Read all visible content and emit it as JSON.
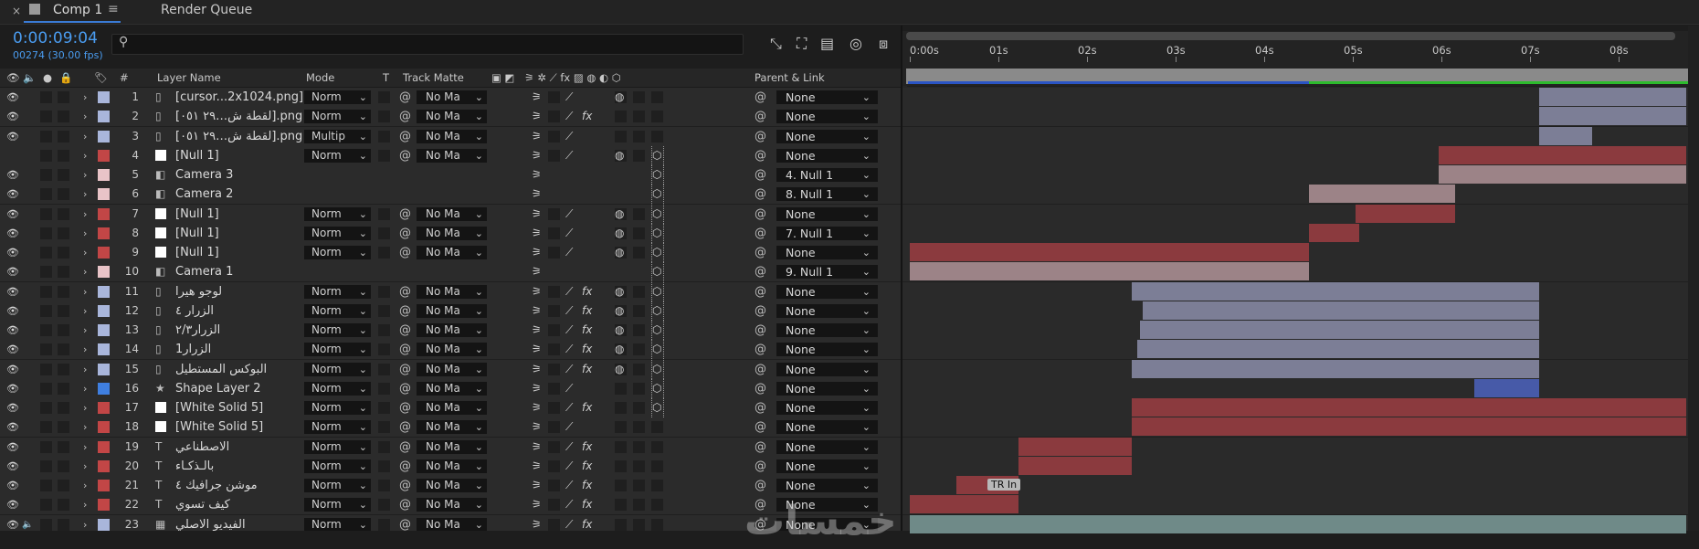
{
  "tabs": [
    {
      "label": "Comp 1",
      "active": true
    },
    {
      "label": "Render Queue",
      "active": false
    }
  ],
  "tab_close_glyph": "×",
  "tab_menu_glyph": "≡",
  "timecode": "0:00:09:04",
  "frame_info": "00274 (30.00 fps)",
  "search_icon_glyph": "⚲",
  "toolbar_icons": [
    {
      "name": "comp-flowchart-icon",
      "glyph": "⤡"
    },
    {
      "name": "draft-3d-icon",
      "glyph": "⛶"
    },
    {
      "name": "frame-blending-icon",
      "glyph": "▤"
    },
    {
      "name": "motion-blur-icon",
      "glyph": "◎"
    },
    {
      "name": "graph-editor-icon",
      "glyph": "⧈"
    }
  ],
  "columns": {
    "layer_name": "Layer Name",
    "mode": "Mode",
    "t": "T",
    "track_matte": "Track Matte",
    "parent": "Parent & Link",
    "num": "#"
  },
  "dropdown_glyph": "⌄",
  "rows": [
    {
      "num": "1",
      "name": "[cursor...2x1024.png]",
      "type": "footage",
      "color": "#a9b6db",
      "mode": "Norm",
      "matte": "No Ma",
      "parent": "None",
      "eye": true,
      "audio": false,
      "fx": false,
      "motionblur": true,
      "three_d": false,
      "solid_icon": false
    },
    {
      "num": "2",
      "name": "[لقطة ش…٢٩ ٠٥١].png",
      "type": "footage",
      "color": "#a9b6db",
      "mode": "Norm",
      "matte": "No Ma",
      "parent": "None",
      "eye": true,
      "audio": false,
      "fx": true,
      "motionblur": false,
      "three_d": false
    },
    {
      "num": "3",
      "name": "[لقطة ش…٢٩ ٠٥١].png",
      "type": "footage",
      "color": "#a9b6db",
      "mode": "Multip",
      "matte": "No Ma",
      "parent": "None",
      "eye": true,
      "audio": false,
      "fx": false,
      "motionblur": false,
      "three_d": false
    },
    {
      "num": "4",
      "name": "[Null 1]",
      "type": "null",
      "color": "#c24646",
      "mode": "Norm",
      "matte": "No Ma",
      "parent": "None",
      "eye": false,
      "audio": false,
      "fx": false,
      "motionblur": true,
      "three_d": true
    },
    {
      "num": "5",
      "name": "Camera 3",
      "type": "camera",
      "color": "#e9c4c8",
      "mode": "",
      "matte": "",
      "parent": "4. Null 1",
      "eye": true,
      "audio": false,
      "fx": false,
      "motionblur": false,
      "three_d": true
    },
    {
      "num": "6",
      "name": "Camera 2",
      "type": "camera",
      "color": "#e9c4c8",
      "mode": "",
      "matte": "",
      "parent": "8. Null 1",
      "eye": true,
      "audio": false,
      "fx": false,
      "motionblur": false,
      "three_d": true
    },
    {
      "num": "7",
      "name": "[Null 1]",
      "type": "null",
      "color": "#c24646",
      "mode": "Norm",
      "matte": "No Ma",
      "parent": "None",
      "eye": true,
      "audio": false,
      "fx": false,
      "motionblur": true,
      "three_d": true
    },
    {
      "num": "8",
      "name": "[Null 1]",
      "type": "null",
      "color": "#c24646",
      "mode": "Norm",
      "matte": "No Ma",
      "parent": "7. Null 1",
      "eye": true,
      "audio": false,
      "fx": false,
      "motionblur": true,
      "three_d": true
    },
    {
      "num": "9",
      "name": "[Null 1]",
      "type": "null",
      "color": "#c24646",
      "mode": "Norm",
      "matte": "No Ma",
      "parent": "None",
      "eye": true,
      "audio": false,
      "fx": false,
      "motionblur": true,
      "three_d": true
    },
    {
      "num": "10",
      "name": "Camera 1",
      "type": "camera",
      "color": "#e9c4c8",
      "mode": "",
      "matte": "",
      "parent": "9. Null 1",
      "eye": true,
      "audio": false,
      "fx": false,
      "motionblur": false,
      "three_d": true
    },
    {
      "num": "11",
      "name": "لوجو هيرا",
      "type": "footage",
      "color": "#a9b6db",
      "mode": "Norm",
      "matte": "No Ma",
      "parent": "None",
      "eye": true,
      "audio": false,
      "fx": true,
      "motionblur": true,
      "three_d": true
    },
    {
      "num": "12",
      "name": "الزرار ٤",
      "type": "footage",
      "color": "#a9b6db",
      "mode": "Norm",
      "matte": "No Ma",
      "parent": "None",
      "eye": true,
      "audio": false,
      "fx": true,
      "motionblur": true,
      "three_d": true
    },
    {
      "num": "13",
      "name": "الزرار٢/٣",
      "type": "footage",
      "color": "#a9b6db",
      "mode": "Norm",
      "matte": "No Ma",
      "parent": "None",
      "eye": true,
      "audio": false,
      "fx": true,
      "motionblur": true,
      "three_d": true
    },
    {
      "num": "14",
      "name": "الزرار1",
      "type": "footage",
      "color": "#a9b6db",
      "mode": "Norm",
      "matte": "No Ma",
      "parent": "None",
      "eye": true,
      "audio": false,
      "fx": true,
      "motionblur": true,
      "three_d": true
    },
    {
      "num": "15",
      "name": "البوكس المستطيل",
      "type": "footage",
      "color": "#a9b6db",
      "mode": "Norm",
      "matte": "No Ma",
      "parent": "None",
      "eye": true,
      "audio": false,
      "fx": true,
      "motionblur": true,
      "three_d": true
    },
    {
      "num": "16",
      "name": "Shape Layer 2",
      "type": "shape",
      "color": "#3f7fe0",
      "mode": "Norm",
      "matte": "No Ma",
      "parent": "None",
      "eye": true,
      "audio": false,
      "fx": false,
      "motionblur": false,
      "three_d": true
    },
    {
      "num": "17",
      "name": "[White Solid 5]",
      "type": "solid",
      "color": "#c24646",
      "mode": "Norm",
      "matte": "No Ma",
      "parent": "None",
      "eye": true,
      "audio": false,
      "fx": true,
      "motionblur": false,
      "three_d": true
    },
    {
      "num": "18",
      "name": "[White Solid 5]",
      "type": "solid",
      "color": "#c24646",
      "mode": "Norm",
      "matte": "No Ma",
      "parent": "None",
      "eye": true,
      "audio": false,
      "fx": false,
      "motionblur": false,
      "three_d": false
    },
    {
      "num": "19",
      "name": "الاصطناعي",
      "type": "text",
      "color": "#c24646",
      "mode": "Norm",
      "matte": "No Ma",
      "parent": "None",
      "eye": true,
      "audio": false,
      "fx": true,
      "motionblur": false,
      "three_d": false
    },
    {
      "num": "20",
      "name": "بالـذكـاء",
      "type": "text",
      "color": "#c24646",
      "mode": "Norm",
      "matte": "No Ma",
      "parent": "None",
      "eye": true,
      "audio": false,
      "fx": true,
      "motionblur": false,
      "three_d": false
    },
    {
      "num": "21",
      "name": "موشن جرافيك ٤",
      "type": "text",
      "color": "#c24646",
      "mode": "Norm",
      "matte": "No Ma",
      "parent": "None",
      "eye": true,
      "audio": false,
      "fx": true,
      "motionblur": false,
      "three_d": false
    },
    {
      "num": "22",
      "name": "كيف تسوي",
      "type": "text",
      "color": "#c24646",
      "mode": "Norm",
      "matte": "No Ma",
      "parent": "None",
      "eye": true,
      "audio": false,
      "fx": true,
      "motionblur": false,
      "three_d": false
    },
    {
      "num": "23",
      "name": "الفيديو الاصلي",
      "type": "video",
      "color": "#a9b6db",
      "mode": "Norm",
      "matte": "No Ma",
      "parent": "None",
      "eye": true,
      "audio": true,
      "fx": true,
      "motionblur": false,
      "three_d": false
    }
  ],
  "timeline": {
    "ticks": [
      "0:00s",
      "01s",
      "02s",
      "03s",
      "04s",
      "05s",
      "06s",
      "07s",
      "08s"
    ],
    "work_area_green_start_s": 4.5,
    "layer_bars": [
      {
        "row": 1,
        "start": 7.1,
        "end": 9.1,
        "color": "#7c7e96"
      },
      {
        "row": 2,
        "start": 7.1,
        "end": 9.1,
        "color": "#7c7e96"
      },
      {
        "row": 3,
        "start": 7.1,
        "end": 7.7,
        "color": "#7c7e96"
      },
      {
        "row": 4,
        "start": 5.97,
        "end": 9.1,
        "color": "#8b3a3e"
      },
      {
        "row": 5,
        "start": 5.97,
        "end": 9.1,
        "color": "#9c8387"
      },
      {
        "row": 6,
        "start": 4.5,
        "end": 6.15,
        "color": "#9c8387"
      },
      {
        "row": 7,
        "start": 5.03,
        "end": 6.15,
        "color": "#8b3a3e"
      },
      {
        "row": 8,
        "start": 4.5,
        "end": 5.07,
        "color": "#8b3a3e"
      },
      {
        "row": 9,
        "start": 0.0,
        "end": 4.5,
        "color": "#8b3a3e"
      },
      {
        "row": 10,
        "start": 0.0,
        "end": 4.5,
        "color": "#9c8387"
      },
      {
        "row": 11,
        "start": 2.5,
        "end": 7.1,
        "color": "#7c7e96"
      },
      {
        "row": 12,
        "start": 2.63,
        "end": 7.1,
        "color": "#7c7e96"
      },
      {
        "row": 13,
        "start": 2.6,
        "end": 7.1,
        "color": "#7c7e96"
      },
      {
        "row": 14,
        "start": 2.57,
        "end": 7.1,
        "color": "#7c7e96"
      },
      {
        "row": 15,
        "start": 2.5,
        "end": 7.1,
        "color": "#7c7e96"
      },
      {
        "row": 16,
        "start": 6.37,
        "end": 7.1,
        "color": "#475aa8"
      },
      {
        "row": 17,
        "start": 2.5,
        "end": 9.1,
        "color": "#8b3a3e"
      },
      {
        "row": 18,
        "start": 2.5,
        "end": 9.1,
        "color": "#8b3a3e"
      },
      {
        "row": 19,
        "start": 1.23,
        "end": 2.5,
        "color": "#8b3a3e"
      },
      {
        "row": 20,
        "start": 1.23,
        "end": 2.5,
        "color": "#8b3a3e"
      },
      {
        "row": 21,
        "start": 0.53,
        "end": 1.23,
        "color": "#8b3a3e"
      },
      {
        "row": 22,
        "start": 0.0,
        "end": 1.23,
        "color": "#8b3a3e"
      },
      {
        "row": 23,
        "start": 0.0,
        "end": 9.1,
        "color": "#6f8a88"
      }
    ],
    "keyframe_label": "TR In",
    "keyframe_row": 21,
    "keyframe_time_s": 0.88
  },
  "watermark": "خمسات"
}
